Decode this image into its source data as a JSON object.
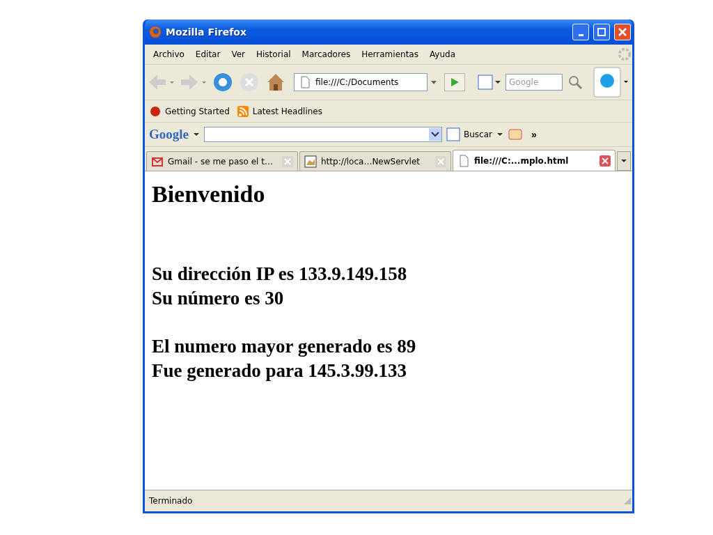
{
  "window": {
    "title": "Mozilla Firefox"
  },
  "menu": [
    "Archivo",
    "Editar",
    "Ver",
    "Historial",
    "Marcadores",
    "Herramientas",
    "Ayuda"
  ],
  "navigation": {
    "url": "file:///C:/Documents",
    "search_placeholder": "Google"
  },
  "bookmarks": [
    {
      "kind": "page",
      "label": "Getting Started"
    },
    {
      "kind": "feed",
      "label": "Latest Headlines"
    }
  ],
  "google_toolbar": {
    "logo": "Google",
    "search_button": "Buscar",
    "overflow": "»"
  },
  "tabs": [
    {
      "kind": "mail",
      "label": "Gmail - se me paso el t…",
      "selected": false
    },
    {
      "kind": "servlet",
      "label": "http://loca…NewServlet",
      "selected": false
    },
    {
      "kind": "file",
      "label": "file:///C:...mplo.html",
      "selected": true
    }
  ],
  "content": {
    "heading": "Bienvenido",
    "paragraphs": [
      [
        "Su dirección IP es 133.9.149.158",
        "Su número es 30"
      ],
      [
        "El numero mayor generado es 89",
        "Fue generado para 145.3.99.133"
      ]
    ]
  },
  "status_bar": "Terminado"
}
